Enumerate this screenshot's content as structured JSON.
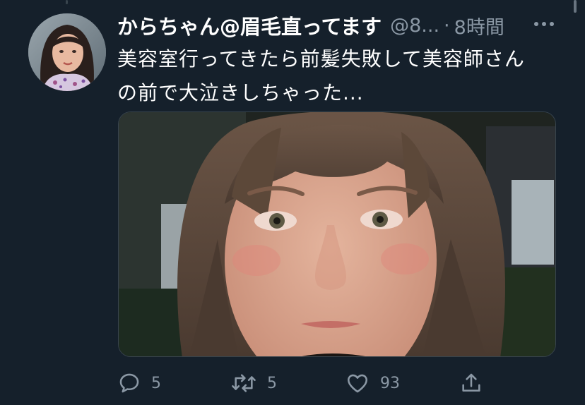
{
  "tweet": {
    "display_name": "からちゃん@眉毛直ってます",
    "handle": "@8...",
    "separator": "·",
    "time": "8時間",
    "text_line1": "美容室行ってきたら前髪失敗して美容師さん",
    "text_line2": "の前で大泣きしちゃった..."
  },
  "actions": {
    "reply_count": "5",
    "retweet_count": "5",
    "like_count": "93"
  },
  "colors": {
    "background": "#15202b",
    "secondary_text": "#8b98a5",
    "border": "#38444d"
  },
  "icons": [
    "reply-icon",
    "retweet-icon",
    "like-icon",
    "share-icon",
    "more-icon"
  ]
}
